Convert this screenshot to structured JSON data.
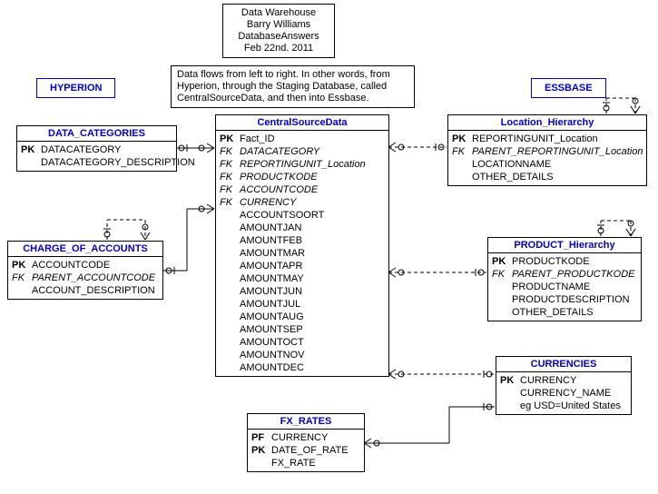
{
  "meta": {
    "line1": "Data Warehouse",
    "line2": "Barry Williams",
    "line3": "DatabaseAnswers",
    "line4": "Feb 22nd. 2011"
  },
  "flow_note": "Data flows from left to right. In other words, from Hyperion, through the Staging Database, called CentralSourceData, and then into Essbase.",
  "labels": {
    "hyperion": "HYPERION",
    "essbase": "ESSBASE"
  },
  "entities": {
    "data_categories": {
      "title": "DATA_CATEGORIES",
      "attrs": [
        {
          "key": "PK",
          "name": "DATACATEGORY",
          "fk": false
        },
        {
          "key": "",
          "name": "DATACATEGORY_DESCRIPTION",
          "fk": false
        }
      ]
    },
    "charge_of_accounts": {
      "title": "CHARGE_OF_ACCOUNTS",
      "attrs": [
        {
          "key": "PK",
          "name": "ACCOUNTCODE",
          "fk": false
        },
        {
          "key": "FK",
          "name": "PARENT_ACCOUNTCODE",
          "fk": true
        },
        {
          "key": "",
          "name": "ACCOUNT_DESCRIPTION",
          "fk": false
        }
      ]
    },
    "central": {
      "title": "CentralSourceData",
      "attrs": [
        {
          "key": "PK",
          "name": "Fact_ID",
          "fk": false
        },
        {
          "key": "FK",
          "name": "DATACATEGORY",
          "fk": true
        },
        {
          "key": "FK",
          "name": "REPORTINGUNIT_Location",
          "fk": true
        },
        {
          "key": "FK",
          "name": "PRODUCTKODE",
          "fk": true
        },
        {
          "key": "FK",
          "name": "ACCOUNTCODE",
          "fk": true
        },
        {
          "key": "FK",
          "name": "CURRENCY",
          "fk": true
        },
        {
          "key": "",
          "name": "ACCOUNTSOORT",
          "fk": false
        },
        {
          "key": "",
          "name": "AMOUNTJAN",
          "fk": false
        },
        {
          "key": "",
          "name": "AMOUNTFEB",
          "fk": false
        },
        {
          "key": "",
          "name": "AMOUNTMAR",
          "fk": false
        },
        {
          "key": "",
          "name": "AMOUNTAPR",
          "fk": false
        },
        {
          "key": "",
          "name": "AMOUNTMAY",
          "fk": false
        },
        {
          "key": "",
          "name": "AMOUNTJUN",
          "fk": false
        },
        {
          "key": "",
          "name": "AMOUNTJUL",
          "fk": false
        },
        {
          "key": "",
          "name": "AMOUNTAUG",
          "fk": false
        },
        {
          "key": "",
          "name": "AMOUNTSEP",
          "fk": false
        },
        {
          "key": "",
          "name": "AMOUNTOCT",
          "fk": false
        },
        {
          "key": "",
          "name": "AMOUNTNOV",
          "fk": false
        },
        {
          "key": "",
          "name": "AMOUNTDEC",
          "fk": false
        }
      ]
    },
    "location_hierarchy": {
      "title": "Location_Hierarchy",
      "attrs": [
        {
          "key": "PK",
          "name": "REPORTINGUNIT_Location",
          "fk": false
        },
        {
          "key": "FK",
          "name": "PARENT_REPORTINGUNIT_Location",
          "fk": true
        },
        {
          "key": "",
          "name": "LOCATIONNAME",
          "fk": false
        },
        {
          "key": "",
          "name": "OTHER_DETAILS",
          "fk": false
        }
      ]
    },
    "product_hierarchy": {
      "title": "PRODUCT_Hierarchy",
      "attrs": [
        {
          "key": "PK",
          "name": "PRODUCTKODE",
          "fk": false
        },
        {
          "key": "FK",
          "name": "PARENT_PRODUCTKODE",
          "fk": true
        },
        {
          "key": "",
          "name": "PRODUCTNAME",
          "fk": false
        },
        {
          "key": "",
          "name": "PRODUCTDESCRIPTION",
          "fk": false
        },
        {
          "key": "",
          "name": "OTHER_DETAILS",
          "fk": false
        }
      ]
    },
    "currencies": {
      "title": "CURRENCIES",
      "attrs": [
        {
          "key": "PK",
          "name": "CURRENCY",
          "fk": false
        },
        {
          "key": "",
          "name": "CURRENCY_NAME",
          "fk": false
        },
        {
          "key": "",
          "name": "eg USD=United States",
          "fk": false
        }
      ]
    },
    "fx_rates": {
      "title": "FX_RATES",
      "attrs": [
        {
          "key": "PF",
          "name": "CURRENCY",
          "fk": false
        },
        {
          "key": "PK",
          "name": "DATE_OF_RATE",
          "fk": false
        },
        {
          "key": "",
          "name": "FX_RATE",
          "fk": false
        }
      ]
    }
  }
}
